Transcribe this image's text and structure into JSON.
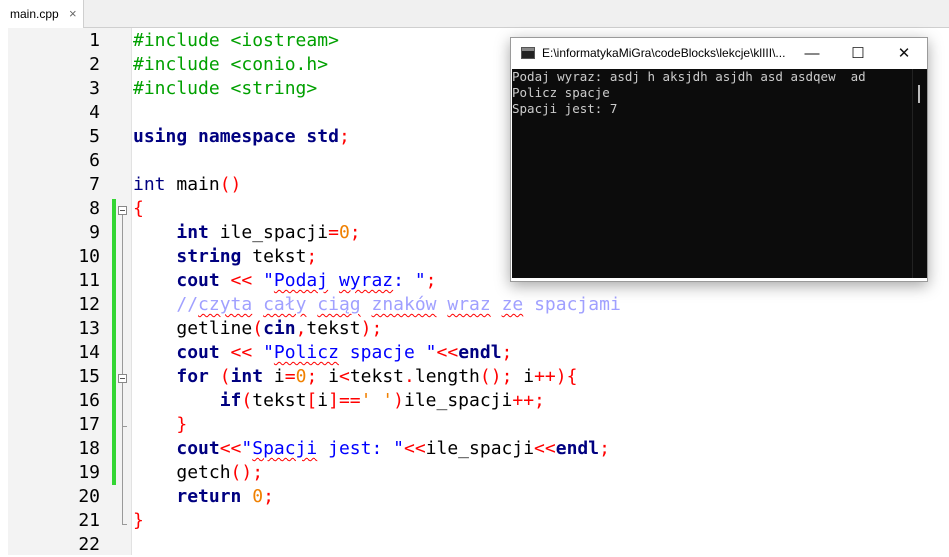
{
  "tab": {
    "label": "main.cpp",
    "close": "×"
  },
  "editor": {
    "line_numbers": [
      "1",
      "2",
      "3",
      "4",
      "5",
      "6",
      "7",
      "8",
      "9",
      "10",
      "11",
      "12",
      "13",
      "14",
      "15",
      "16",
      "17",
      "18",
      "19",
      "20",
      "21",
      "22"
    ],
    "code": {
      "l1_pp": "#include <iostream>",
      "l2_pp": "#include <conio.h>",
      "l3_pp": "#include <string>",
      "l5_kw1": "using",
      "l5_kw2": "namespace",
      "l5_kw3": "std",
      "l5_semi": ";",
      "l7_type": "int",
      "l7_name": " main",
      "l7_paren": "()",
      "l8_brace": "{",
      "l9_type": "int",
      "l9_var": " ile_spacji",
      "l9_eq": "=",
      "l9_num": "0",
      "l9_semi": ";",
      "l10_kw": "string",
      "l10_var": " tekst",
      "l10_semi": ";",
      "l11_kw": "cout",
      "l11_op": " <<",
      "l11_str_a": " \"",
      "l11_str_sq1": "Podaj",
      "l11_str_sp": " ",
      "l11_str_sq2": "wyraz",
      "l11_str_b": ": \"",
      "l11_semi": ";",
      "l12_c1": "//",
      "l12_sq1": "czyta",
      "l12_c2": " ",
      "l12_sq2": "cały",
      "l12_c3": " ",
      "l12_sq3": "ciąg",
      "l12_c4": " ",
      "l12_sq4": "znaków",
      "l12_c5": " ",
      "l12_sq5": "wraz",
      "l12_c6": " ",
      "l12_sq6": "ze",
      "l12_c7": " spacjami",
      "l13_fn": "getline",
      "l13_p1": "(",
      "l13_kw": "cin",
      "l13_comma": ",",
      "l13_var": "tekst",
      "l13_p2": ");",
      "l14_kw": "cout",
      "l14_op1": " <<",
      "l14_str_a": " \"",
      "l14_sq": "Policz",
      "l14_str_b": " spacje \"",
      "l14_op2": "<<",
      "l14_kw2": "endl",
      "l14_semi": ";",
      "l15_kw": "for",
      "l15_p1": " (",
      "l15_type": "int",
      "l15_i": " i",
      "l15_eq": "=",
      "l15_num": "0",
      "l15_s1": ";",
      "l15_i2": " i",
      "l15_lt": "<",
      "l15_tl": "tekst",
      "l15_dot": ".",
      "l15_len": "length",
      "l15_pp": "();",
      "l15_i3": " i",
      "l15_inc": "++){",
      "l16_kw": "if",
      "l16_p1": "(",
      "l16_t": "tekst",
      "l16_b1": "[",
      "l16_i": "i",
      "l16_b2": "]==",
      "l16_chr": "' '",
      "l16_p2": ")",
      "l16_v": "ile_spacji",
      "l16_inc": "++;",
      "l17_brace": "}",
      "l18_kw": "cout",
      "l18_op1": "<<",
      "l18_str_a": "\"",
      "l18_sq": "Spacji",
      "l18_str_b": " jest: \"",
      "l18_op2": "<<",
      "l18_v": "ile_spacji",
      "l18_op3": "<<",
      "l18_kw2": "endl",
      "l18_semi": ";",
      "l19_fn": "getch",
      "l19_p": "();",
      "l20_kw": "return",
      "l20_num": " 0",
      "l20_semi": ";",
      "l21_brace": "}"
    }
  },
  "console": {
    "title": "E:\\informatykaMiGra\\codeBlocks\\lekcje\\klIII\\...",
    "minimize": "—",
    "maximize": "☐",
    "close": "✕",
    "lines": [
      "Podaj wyraz: asdj h aksjdh asjdh asd asdqew  ad",
      "Policz spacje",
      "Spacji jest: 7"
    ]
  },
  "colors": {
    "preprocessor": "#00a000",
    "keyword": "#000080",
    "operator": "#ff0000",
    "number": "#f08000",
    "string": "#0000ff",
    "comment": "#a0a0ff",
    "change_bar": "#33d633",
    "console_bg": "#0c0c0c"
  }
}
